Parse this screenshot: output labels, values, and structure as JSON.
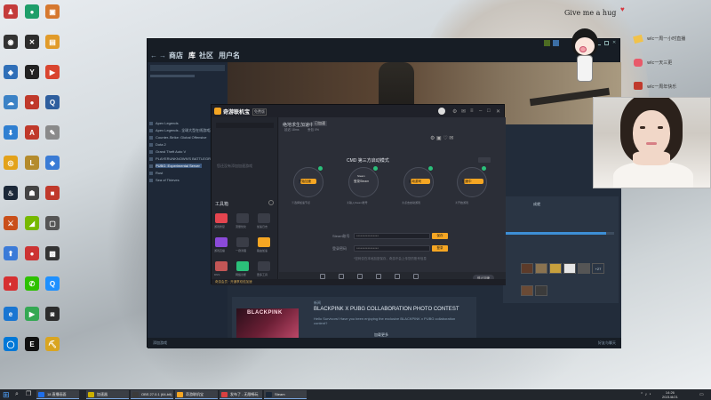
{
  "desktop": {
    "icons": [
      {
        "name": "avatar-app-icon",
        "color": "#c43b3b",
        "glyph": "♟"
      },
      {
        "name": "green-app-icon",
        "color": "#1e9e6a",
        "glyph": "●"
      },
      {
        "name": "orange-app-icon",
        "color": "#d6782f",
        "glyph": "▣"
      },
      {
        "name": "obs-icon",
        "color": "#333",
        "glyph": "◉"
      },
      {
        "name": "razer-icon",
        "color": "#2d2d2d",
        "glyph": "✕"
      },
      {
        "name": "folder-app-icon",
        "color": "#e19b2a",
        "glyph": "▤"
      },
      {
        "name": "network-icon",
        "color": "#2f6fb8",
        "glyph": "◈"
      },
      {
        "name": "yy-icon",
        "color": "#222",
        "glyph": "Y"
      },
      {
        "name": "red-app-icon",
        "color": "#d9452f",
        "glyph": "▶"
      },
      {
        "name": "cloud-icon",
        "color": "#3b82c6",
        "glyph": "☁"
      },
      {
        "name": "among-icon",
        "color": "#c0392b",
        "glyph": "●"
      },
      {
        "name": "qq-game-icon",
        "color": "#2e5e9e",
        "glyph": "Q"
      },
      {
        "name": "download-icon",
        "color": "#2f7fd1",
        "glyph": "⬇"
      },
      {
        "name": "adobe-icon",
        "color": "#c0392b",
        "glyph": "A"
      },
      {
        "name": "pen-icon",
        "color": "#8a8a8a",
        "glyph": "✎"
      },
      {
        "name": "chrome-icon",
        "color": "#e3a21a",
        "glyph": "◎"
      },
      {
        "name": "lol-icon",
        "color": "#b48b2c",
        "glyph": "L"
      },
      {
        "name": "blue-app-icon",
        "color": "#3a7bd5",
        "glyph": "◆"
      },
      {
        "name": "steam-icon",
        "color": "#1b2838",
        "glyph": "♨"
      },
      {
        "name": "robot-icon",
        "color": "#444",
        "glyph": "☗"
      },
      {
        "name": "red-box-icon",
        "color": "#c0392b",
        "glyph": "■"
      },
      {
        "name": "game-icon",
        "color": "#c94f1a",
        "glyph": "⚔"
      },
      {
        "name": "nvidia-icon",
        "color": "#76b900",
        "glyph": "◢"
      },
      {
        "name": "app-blank-icon",
        "color": "#555",
        "glyph": "▢"
      },
      {
        "name": "upload-icon",
        "color": "#3b7bd8",
        "glyph": "⬆"
      },
      {
        "name": "among2-icon",
        "color": "#c33",
        "glyph": "●"
      },
      {
        "name": "dark-app-icon",
        "color": "#333",
        "glyph": "▩"
      },
      {
        "name": "netease-icon",
        "color": "#d63031",
        "glyph": "◐"
      },
      {
        "name": "wechat-icon",
        "color": "#2dc100",
        "glyph": "✆"
      },
      {
        "name": "qq-icon",
        "color": "#1e90ff",
        "glyph": "Q"
      },
      {
        "name": "blue-globe-icon",
        "color": "#1976d2",
        "glyph": "e"
      },
      {
        "name": "play-store-icon",
        "color": "#34a853",
        "glyph": "▶"
      },
      {
        "name": "pc-game-icon",
        "color": "#2c2c2c",
        "glyph": "◙"
      },
      {
        "name": "blue-circle-icon",
        "color": "#0078d7",
        "glyph": "◯"
      },
      {
        "name": "epic-icon",
        "color": "#111",
        "glyph": "E"
      },
      {
        "name": "minecraft-icon",
        "color": "#d9a521",
        "glyph": "⛏"
      }
    ]
  },
  "steam": {
    "nav": [
      "商店",
      "库",
      "社区",
      "用户名"
    ],
    "sidebar_items": [
      "Apex Legends",
      "Apex Legends - 全球大型在线游戏测试服",
      "Counter-Strike: Global Offensive",
      "Dota 2",
      "Grand Theft Auto V",
      "PLAYERUNKNOWN'S BATTLEGROUNDS",
      "PUBG: Experimental Server",
      "Rust",
      "Sea of Thieves"
    ],
    "news": {
      "tag": "新闻",
      "title": "BLACKPINK X PUBG COLLABORATION PHOTO CONTEST",
      "body": "Hello Survivors! Have you been enjoying the exclusive BLACKPINK x PUBG collaboration content?",
      "footer": "加载更多"
    },
    "panel_label": "成就",
    "progress_fraction": 0.93,
    "more_count": "+27",
    "bottom_left": "添加游戏",
    "bottom_right": "好友与聊天"
  },
  "booster": {
    "brand": "奇游联机宝",
    "tab_label": "免费版",
    "game_title": "绝地求生加速中",
    "badge": "已加速",
    "stats": [
      "延迟 18ms",
      "丢包 0%"
    ],
    "mode_title": "CMD 第三方启动模式",
    "steps": [
      {
        "top": "",
        "label": "开始加速",
        "caption": "①选择加速节点"
      },
      {
        "top": "Steam",
        "label": "登录Steam",
        "caption": "②输入Steam账号"
      },
      {
        "top": "",
        "label": "启动游戏",
        "caption": "③点击启动游戏"
      },
      {
        "top": "",
        "label": "加速中",
        "caption": "④开始游戏"
      }
    ],
    "fields": [
      {
        "label": "Steam账号",
        "value": "****************",
        "btn": "保存"
      },
      {
        "label": "登录密码",
        "value": "****************",
        "btn": "登录"
      }
    ],
    "field_hint": "*密码仅在本地加密保存，奇游不会上传您的账号信息",
    "left_empty": "您还没有添加加速游戏",
    "tools_title": "工具箱",
    "tools": [
      "游戏修复",
      "流量优化",
      "加速日志",
      "游戏直播",
      "一键清理",
      "路由加速",
      "DNS",
      "网络诊断",
      "更多工具"
    ],
    "bottom_icons": [
      "网络诊断",
      "游戏修复",
      "加速日志",
      "流量优化",
      "客服中心",
      "更多"
    ],
    "stop_button": "停止加速",
    "promo": "奇游会员 · 开通享双倍加速"
  },
  "stickers": {
    "hug": "Give me a hug",
    "lines": [
      "wlc一周一小时直播",
      "wlc一天三更",
      "wlc一周年快乐"
    ]
  },
  "taskbar": {
    "items": [
      "18 直播画面",
      "加速器",
      "OBS 27.0.1 (64-bit)",
      "奇游联机宝",
      "发布了 - 无限畅玩",
      "Steam"
    ],
    "time": "14:26",
    "date": "2021/8/21"
  }
}
